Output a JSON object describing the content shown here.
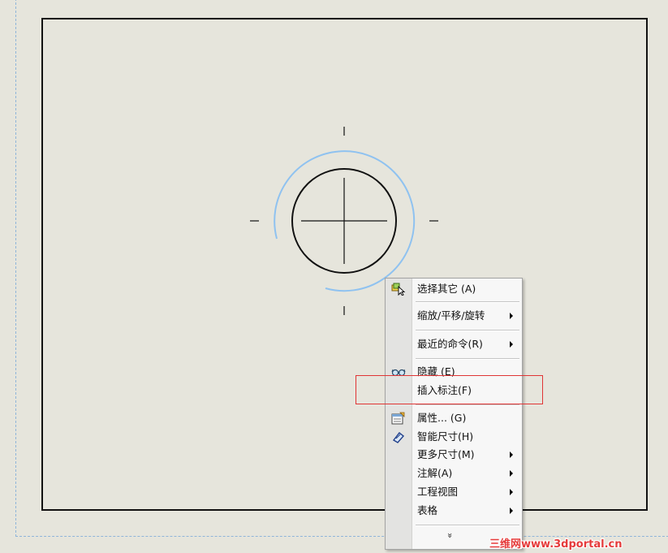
{
  "colors": {
    "canvas": "#e6e5dc",
    "frame": "#111111",
    "selection_arc": "#8fc2f0",
    "highlight": "#e03535",
    "watermark": "#e53b3b"
  },
  "context_menu": {
    "items": [
      {
        "label": "选择其它 (A)",
        "icon": "select-other-icon",
        "submenu": false
      },
      {
        "label": "缩放/平移/旋转",
        "icon": "",
        "submenu": true
      },
      {
        "label": "最近的命令(R)",
        "icon": "",
        "submenu": true
      },
      {
        "label": "隐藏 (E)",
        "icon": "hide-glasses-icon",
        "submenu": false
      },
      {
        "label": "插入标注(F)",
        "icon": "",
        "submenu": false
      },
      {
        "label": "属性... (G)",
        "icon": "properties-icon",
        "submenu": false
      },
      {
        "label": "智能尺寸(H)",
        "icon": "smart-dimension-icon",
        "submenu": false
      },
      {
        "label": "更多尺寸(M)",
        "icon": "",
        "submenu": true
      },
      {
        "label": "注解(A)",
        "icon": "",
        "submenu": true
      },
      {
        "label": "工程视图",
        "icon": "",
        "submenu": true
      },
      {
        "label": "表格",
        "icon": "",
        "submenu": true
      }
    ],
    "expand_glyph": "»"
  },
  "watermark": {
    "text": "三维网www.3dportal.cn"
  }
}
